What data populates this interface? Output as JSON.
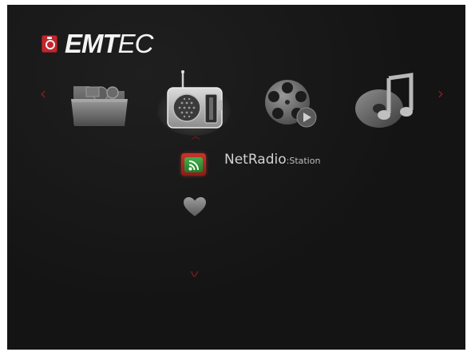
{
  "logo": {
    "brand_bold": "EMT",
    "brand_light": "EC"
  },
  "carousel": {
    "items": [
      {
        "name": "folder",
        "icon": "folder-icon",
        "selected": false
      },
      {
        "name": "radio",
        "icon": "radio-icon",
        "selected": true
      },
      {
        "name": "movie",
        "icon": "film-reel-icon",
        "selected": false
      },
      {
        "name": "music",
        "icon": "music-note-disc-icon",
        "selected": false
      }
    ],
    "prev_arrow": "‹",
    "next_arrow": "›"
  },
  "submenu": {
    "up_arrow": "^",
    "down_arrow": "v",
    "items": [
      {
        "icon": "rss-icon",
        "label": "NetRadio",
        "suffix": ":Station",
        "selected": true
      },
      {
        "icon": "heart-icon",
        "label": "",
        "suffix": "",
        "selected": false
      }
    ]
  },
  "colors": {
    "background": "#141414",
    "accent_red": "#8a1e22",
    "text": "#d2d2d2",
    "rss_green": "#3aa843"
  }
}
